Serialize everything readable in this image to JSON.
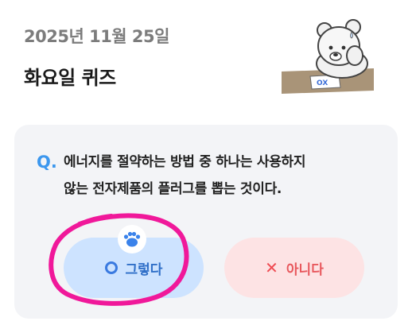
{
  "header": {
    "date": "2025년 11월 25일",
    "title": "화요일 퀴즈"
  },
  "illustration": {
    "icon": "bear-thinking-icon",
    "sign_text": "OX"
  },
  "quiz": {
    "question_mark": "Q.",
    "question_line1": "에너지를 절약하는 방법 중 하나는 사용하지",
    "question_line2": "않는 전자제품의 플러그를 뽑는 것이다."
  },
  "answers": {
    "yes_label": "그렇다",
    "no_label": "아니다",
    "selected_icon": "paw-icon"
  },
  "colors": {
    "accent_blue": "#3c97ee",
    "yes_bg": "#cde3ff",
    "no_bg": "#fde3e4",
    "no_accent": "#ef4b52",
    "annotation": "#f0189a"
  }
}
